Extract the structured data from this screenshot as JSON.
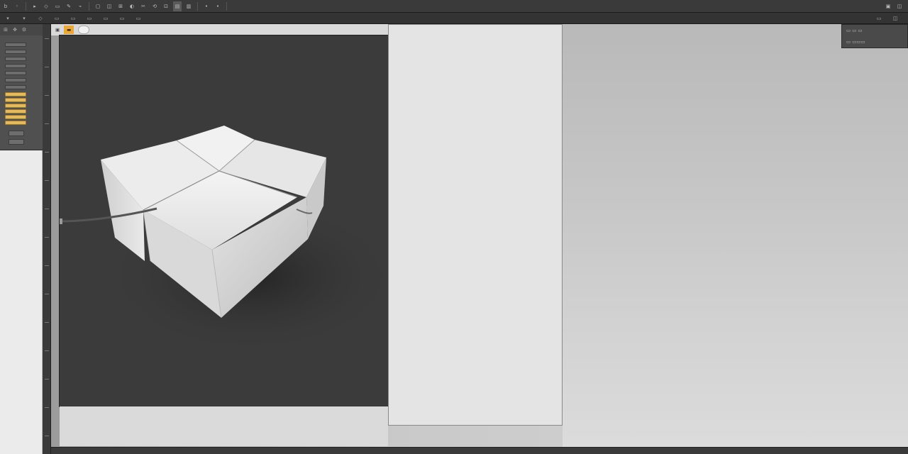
{
  "toolbar": {
    "tools": [
      "b",
      "◦",
      "▸",
      "◇",
      "▭",
      "✎",
      "⌁",
      "▢",
      "◫",
      "⊞",
      "◐",
      "✂",
      "⟲",
      "⊡",
      "▤",
      "▥"
    ],
    "active_tool": "▤",
    "right_tools": [
      "▣",
      "◫"
    ]
  },
  "subbar": {
    "items": [],
    "right_items": []
  },
  "tabs": {
    "items": [
      "▣",
      "▬"
    ],
    "active": "▬"
  },
  "colors": {
    "artboard": "#3b3b3b",
    "paper": "#e4e4e4",
    "accent_tab": "#e8a83a",
    "toolbar": "#3a3a3a"
  },
  "icons": {
    "left_head": [
      "grid-icon",
      "move-icon",
      "settings-icon"
    ]
  }
}
